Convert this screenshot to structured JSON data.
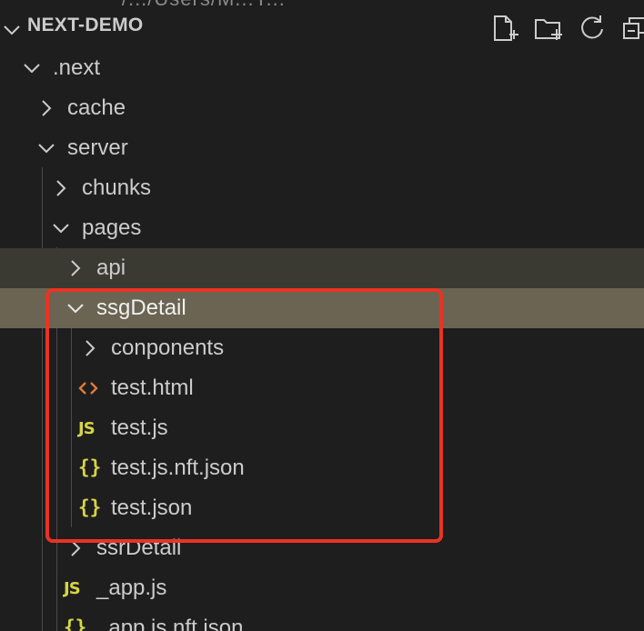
{
  "clipped_path": "~/.../Users/M...Y...",
  "header": {
    "title": "NEXT-DEMO",
    "actions": [
      {
        "name": "new-file-icon"
      },
      {
        "name": "new-folder-icon"
      },
      {
        "name": "refresh-icon"
      },
      {
        "name": "collapse-all-icon"
      }
    ]
  },
  "tree": [
    {
      "label": ".next",
      "type": "folder",
      "expanded": true
    },
    {
      "label": "cache",
      "type": "folder",
      "expanded": false
    },
    {
      "label": "server",
      "type": "folder",
      "expanded": true
    },
    {
      "label": "chunks",
      "type": "folder",
      "expanded": false
    },
    {
      "label": "pages",
      "type": "folder",
      "expanded": true
    },
    {
      "label": "api",
      "type": "folder",
      "expanded": false
    },
    {
      "label": "ssgDetail",
      "type": "folder",
      "expanded": true
    },
    {
      "label": "conponents",
      "type": "folder",
      "expanded": false
    },
    {
      "label": "test.html",
      "type": "html"
    },
    {
      "label": "test.js",
      "type": "js",
      "badge": "JS"
    },
    {
      "label": "test.js.nft.json",
      "type": "json",
      "badge": "{}"
    },
    {
      "label": "test.json",
      "type": "json",
      "badge": "{}"
    },
    {
      "label": "ssrDetail",
      "type": "folder",
      "expanded": false
    },
    {
      "label": "_app.js",
      "type": "js",
      "badge": "JS"
    },
    {
      "label": "_app.js.nft.json",
      "type": "json",
      "badge": "{}"
    }
  ],
  "colors": {
    "background": "#1e1e1e",
    "row_hover": "#3a3a33",
    "row_selected": "#6b6452",
    "highlight_border": "#ea3323",
    "js_badge": "#d7d444",
    "html_icon": "#e07b39"
  }
}
